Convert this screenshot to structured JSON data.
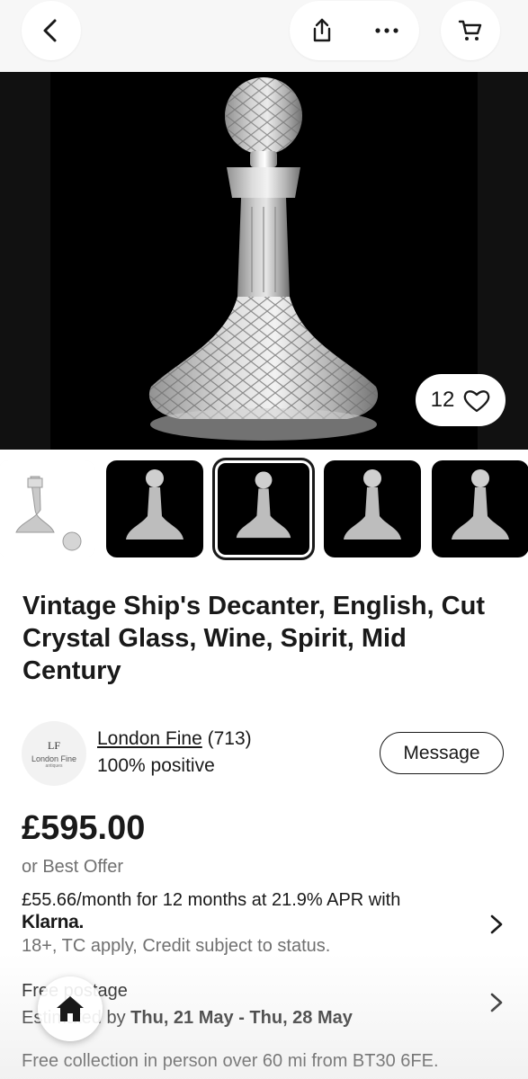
{
  "nav": {
    "back_icon": "chevron-left-icon",
    "share_icon": "share-icon",
    "more_icon": "more-horizontal-icon",
    "cart_icon": "cart-icon"
  },
  "hero": {
    "watchers": "12",
    "heart_icon": "heart-outline-icon"
  },
  "thumbnails": {
    "count": 5,
    "selected_index": 2
  },
  "listing": {
    "title": "Vintage Ship's Decanter, English, Cut Crystal Glass, Wine, Spirit, Mid Century"
  },
  "seller": {
    "avatar_monogram": "LF",
    "avatar_name": "London Fine",
    "avatar_sub": "antiques",
    "name": "London Fine",
    "feedback_count": " (713)",
    "positive": "100% positive",
    "message_label": "Message"
  },
  "price": {
    "amount": "£595.00",
    "best_offer": "or Best Offer"
  },
  "financing": {
    "monthly": "£55.66/month for 12 months at 21.9% APR with",
    "provider": "Klarna.",
    "terms": "18+, TC apply, Credit subject to status."
  },
  "shipping": {
    "line1": "Free postage",
    "line2_prefix": "Estimated by ",
    "line2_dates": "Thu, 21 May - Thu, 28 May",
    "collection": "Free collection in person over 60 mi from BT30 6FE."
  },
  "colors": {
    "text": "#191919",
    "muted": "#707070",
    "topbar": "#f7f7f7",
    "image_bg": "#000000"
  }
}
